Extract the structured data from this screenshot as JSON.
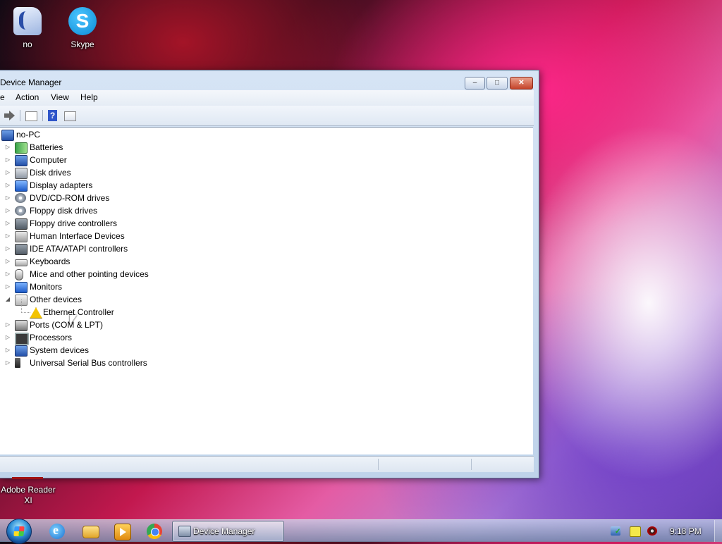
{
  "desktop": {
    "icons": [
      {
        "label": "no",
        "icon": "user-folder-icon"
      },
      {
        "label": "Skype",
        "icon": "skype-icon",
        "glyph": "S"
      },
      {
        "label": "Adobe Reader XI",
        "icon": "adobe-reader-icon"
      }
    ]
  },
  "window": {
    "title": "Device Manager",
    "controls": {
      "minimize": "–",
      "maximize": "□",
      "close": "✕"
    },
    "menu": [
      "e",
      "Action",
      "View",
      "Help"
    ],
    "toolbar": {
      "help_glyph": "?"
    },
    "tree": {
      "root": "no-PC",
      "categories": [
        {
          "label": "Batteries",
          "icon": "battery-icon",
          "expanded": false
        },
        {
          "label": "Computer",
          "icon": "computer-icon",
          "expanded": false
        },
        {
          "label": "Disk drives",
          "icon": "disk-drive-icon",
          "expanded": false
        },
        {
          "label": "Display adapters",
          "icon": "display-adapter-icon",
          "expanded": false
        },
        {
          "label": "DVD/CD-ROM drives",
          "icon": "cd-drive-icon",
          "expanded": false
        },
        {
          "label": "Floppy disk drives",
          "icon": "floppy-disk-icon",
          "expanded": false
        },
        {
          "label": "Floppy drive controllers",
          "icon": "floppy-controller-icon",
          "expanded": false
        },
        {
          "label": "Human Interface Devices",
          "icon": "hid-icon",
          "expanded": false
        },
        {
          "label": "IDE ATA/ATAPI controllers",
          "icon": "ide-controller-icon",
          "expanded": false
        },
        {
          "label": "Keyboards",
          "icon": "keyboard-icon",
          "expanded": false
        },
        {
          "label": "Mice and other pointing devices",
          "icon": "mouse-icon",
          "expanded": false
        },
        {
          "label": "Monitors",
          "icon": "monitor-icon",
          "expanded": false
        },
        {
          "label": "Other devices",
          "icon": "other-devices-icon",
          "expanded": true
        },
        {
          "label": "Ports (COM & LPT)",
          "icon": "port-icon",
          "expanded": false
        },
        {
          "label": "Processors",
          "icon": "processor-icon",
          "expanded": false
        },
        {
          "label": "System devices",
          "icon": "system-device-icon",
          "expanded": false
        },
        {
          "label": "Universal Serial Bus controllers",
          "icon": "usb-icon",
          "expanded": false
        }
      ],
      "other_devices_children": [
        {
          "label": "Ethernet Controller",
          "icon": "warning-device-icon"
        }
      ]
    }
  },
  "taskbar": {
    "pinned": [
      "internet-explorer-icon",
      "folder-icon",
      "media-player-icon",
      "chrome-icon"
    ],
    "active_task": "Device Manager",
    "clock": "9:18 PM"
  },
  "expander_glyphs": {
    "collapsed": "▷",
    "expanded": "◢"
  }
}
